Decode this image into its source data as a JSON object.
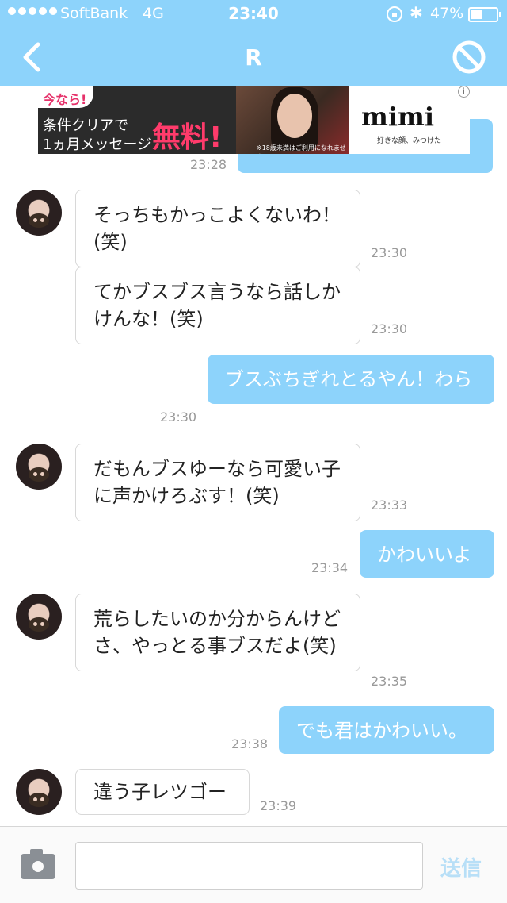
{
  "status_bar": {
    "carrier": "SoftBank",
    "network": "4G",
    "time": "23:40",
    "battery": "47%",
    "battery_level": 0.47
  },
  "nav": {
    "title": "R",
    "back_icon": "chevron-left-icon",
    "block_icon": "block-icon"
  },
  "ad": {
    "promo": "今なら!",
    "line1": "条件クリアで",
    "line2": "1ヵ月メッセージ",
    "free": "無料!",
    "disclaimer": "※18歳未満はご利用になれません",
    "brand": "mimi",
    "tagline": "好きな顔、みつけた",
    "info": "i"
  },
  "messages": [
    {
      "from": "me",
      "text": "",
      "time": "23:28"
    },
    {
      "from": "them",
      "text": "そっちもかっこよくないわ！(笑)",
      "time": "23:30"
    },
    {
      "from": "them",
      "text": "てかブスブス言うなら話しかけんな！(笑)",
      "time": "23:30"
    },
    {
      "from": "me",
      "text": "ブスぶちぎれとるやん！わら",
      "time": "23:30"
    },
    {
      "from": "them",
      "text": "だもんブスゆーなら可愛い子に声かけろぶす！(笑)",
      "time": "23:33"
    },
    {
      "from": "me",
      "text": "かわいいよ",
      "time": "23:34"
    },
    {
      "from": "them",
      "text": "荒らしたいのか分からんけどさ、やっとる事ブスだよ(笑)",
      "time": "23:35"
    },
    {
      "from": "me",
      "text": "でも君はかわいい。",
      "time": "23:38"
    },
    {
      "from": "them",
      "text": "違う子レツゴー",
      "time": "23:39"
    }
  ],
  "composer": {
    "placeholder": "",
    "send_label": "送信",
    "camera_icon": "camera-icon"
  },
  "colors": {
    "accent": "#8dd3fb",
    "incoming_bubble": "#ffffff",
    "outgoing_bubble": "#8dd3fb"
  }
}
